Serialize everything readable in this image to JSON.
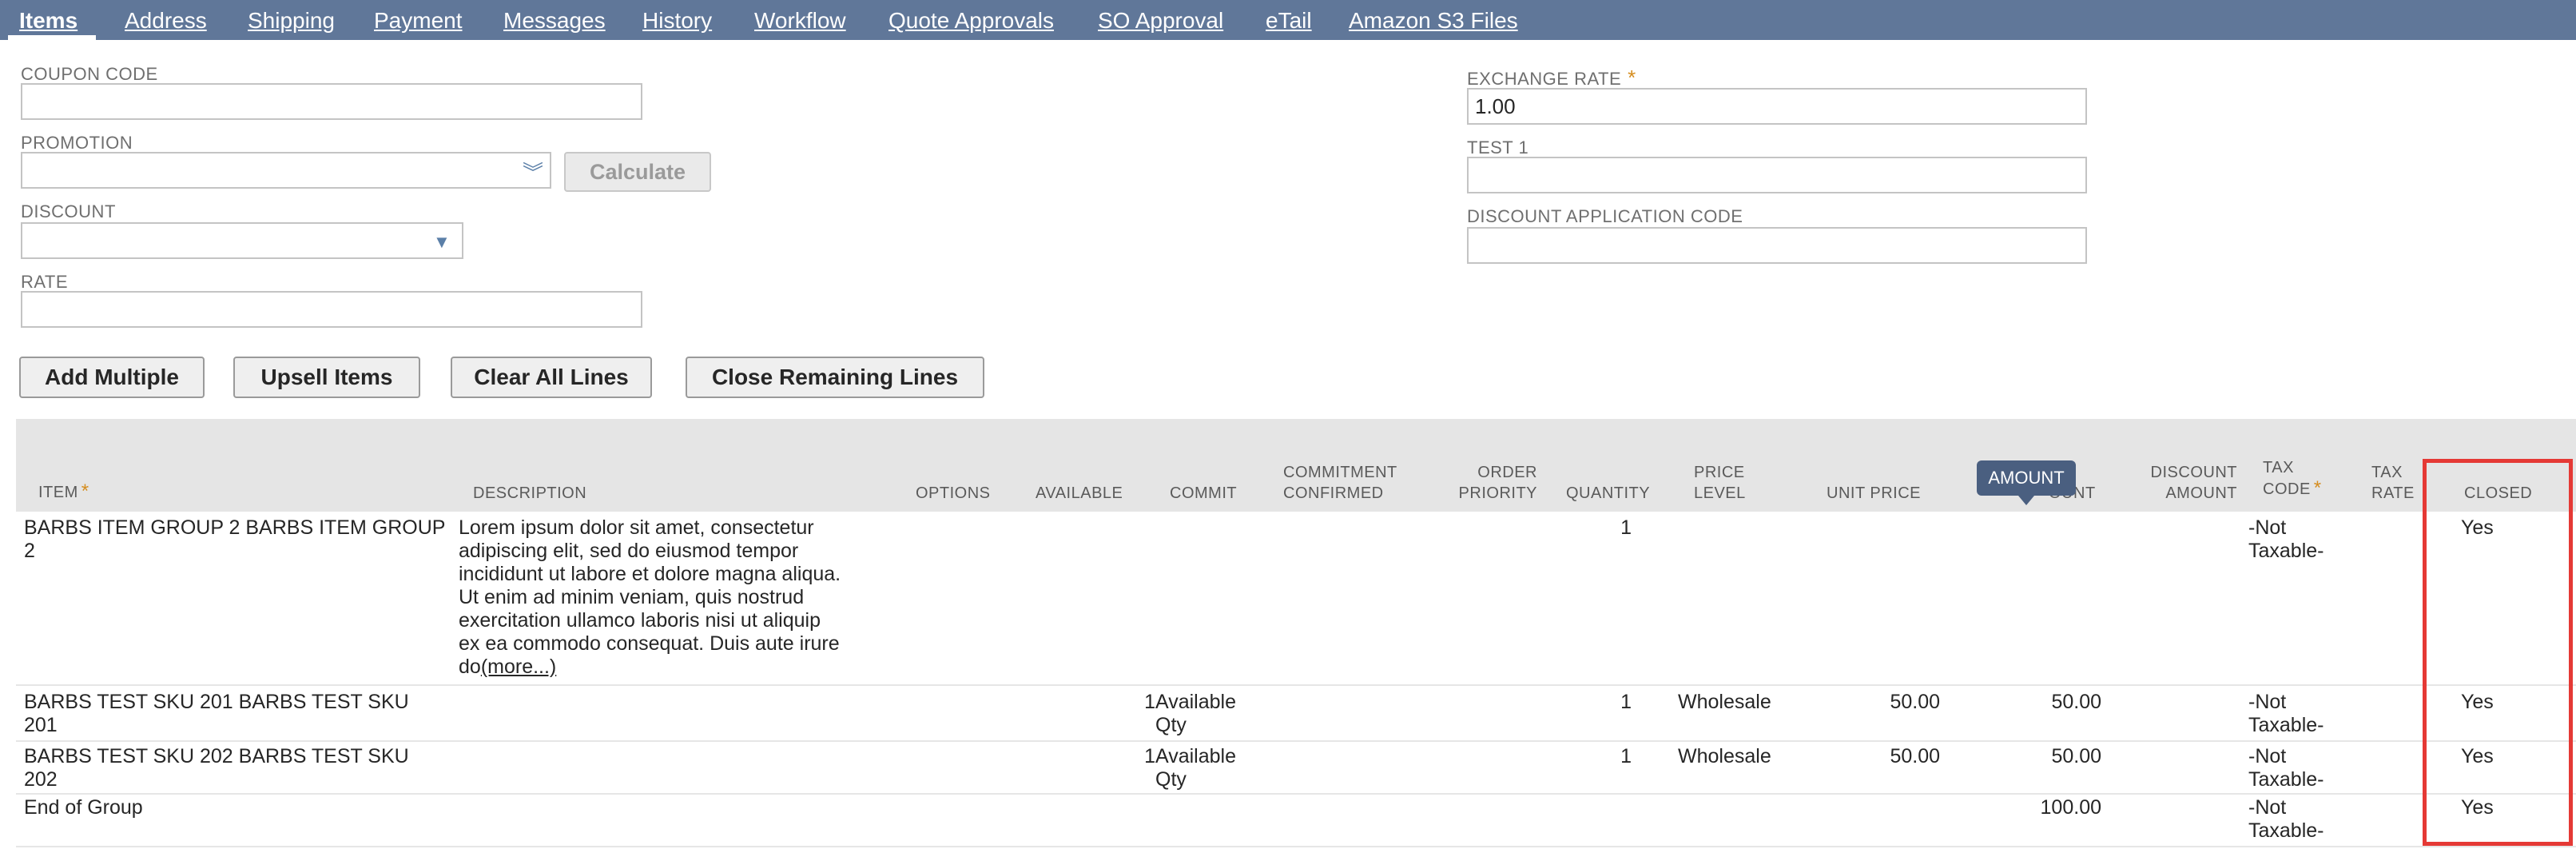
{
  "tabs": [
    {
      "label": "Items"
    },
    {
      "label": "Address"
    },
    {
      "label": "Shipping"
    },
    {
      "label": "Payment"
    },
    {
      "label": "Messages"
    },
    {
      "label": "History"
    },
    {
      "label": "Workflow"
    },
    {
      "label": "Quote Approvals"
    },
    {
      "label": "SO Approval"
    },
    {
      "label": "eTail"
    },
    {
      "label": "Amazon S3 Files"
    }
  ],
  "form": {
    "coupon_code": {
      "label": "COUPON CODE",
      "value": ""
    },
    "promotion": {
      "label": "PROMOTION",
      "value": ""
    },
    "calculate_label": "Calculate",
    "discount": {
      "label": "DISCOUNT",
      "value": ""
    },
    "rate": {
      "label": "RATE",
      "value": ""
    },
    "exchange_rate": {
      "label": "EXCHANGE RATE",
      "value": "1.00"
    },
    "test1": {
      "label": "TEST 1",
      "value": ""
    },
    "discount_app_code": {
      "label": "DISCOUNT APPLICATION CODE",
      "value": ""
    },
    "required_mark": "*"
  },
  "actions": {
    "add_multiple": "Add Multiple",
    "upsell_items": "Upsell Items",
    "clear_all_lines": "Clear All Lines",
    "close_remaining_lines": "Close Remaining Lines"
  },
  "columns": {
    "item": "ITEM",
    "description": "DESCRIPTION",
    "options": "OPTIONS",
    "available": "AVAILABLE",
    "commit": "COMMIT",
    "commitment_confirmed_1": "COMMITMENT",
    "commitment_confirmed_2": "CONFIRMED",
    "order_priority_1": "ORDER",
    "order_priority_2": "PRIORITY",
    "quantity": "QUANTITY",
    "price_level_1": "PRICE",
    "price_level_2": "LEVEL",
    "unit_price": "UNIT PRICE",
    "amount_partial": "OUNT",
    "discount_amount_1": "DISCOUNT",
    "discount_amount_2": "AMOUNT",
    "tax_code_1": "TAX",
    "tax_code_2": "CODE",
    "tax_rate_1": "TAX",
    "tax_rate_2": "RATE",
    "closed": "CLOSED"
  },
  "tooltip": "AMOUNT",
  "rows": [
    {
      "item_1": "BARBS ITEM GROUP 2 BARBS ITEM GROUP",
      "item_2": "2",
      "description_lines": [
        "Lorem ipsum dolor sit amet, consectetur",
        "adipiscing elit, sed do eiusmod tempor",
        "incididunt ut labore et dolore magna aliqua.",
        "Ut enim ad minim veniam, quis nostrud",
        "exercitation ullamco laboris nisi ut aliquip",
        "ex ea commodo consequat. Duis aute irure"
      ],
      "description_last": "do",
      "more_link": "(more...)",
      "quantity": "1",
      "tax_code_1": "-Not",
      "tax_code_2": "Taxable-",
      "closed": "Yes"
    },
    {
      "item_1": "BARBS TEST SKU 201 BARBS TEST SKU",
      "item_2": "201",
      "available": "1",
      "commit_1": "Available",
      "commit_2": "Qty",
      "quantity": "1",
      "price_level": "Wholesale",
      "unit_price": "50.00",
      "amount": "50.00",
      "tax_code_1": "-Not",
      "tax_code_2": "Taxable-",
      "closed": "Yes"
    },
    {
      "item_1": "BARBS TEST SKU 202 BARBS TEST SKU",
      "item_2": "202",
      "available": "1",
      "commit_1": "Available",
      "commit_2": "Qty",
      "quantity": "1",
      "price_level": "Wholesale",
      "unit_price": "50.00",
      "amount": "50.00",
      "tax_code_1": "-Not",
      "tax_code_2": "Taxable-",
      "closed": "Yes"
    },
    {
      "item_1": "End of Group",
      "amount": "100.00",
      "tax_code_1": "-Not",
      "tax_code_2": "Taxable-",
      "closed": "Yes"
    }
  ],
  "colors": {
    "tab_bar": "#607799",
    "required": "#d58d1f",
    "highlight": "#e53935",
    "tooltip": "#4a5f80"
  },
  "icons": {
    "promotion_select": "double-chevron-down-icon",
    "discount_select": "triangle-down-icon"
  }
}
